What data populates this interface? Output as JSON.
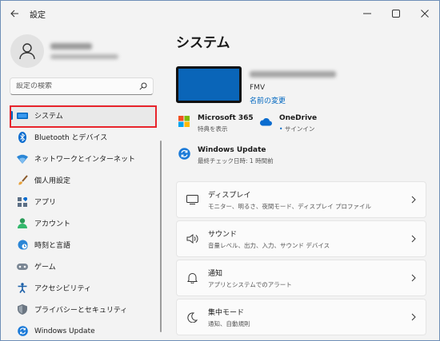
{
  "app": {
    "title": "設定"
  },
  "search": {
    "placeholder": "設定の検索"
  },
  "sidebar": {
    "items": [
      {
        "label": "システム",
        "icon": "monitor-icon",
        "active": true
      },
      {
        "label": "Bluetooth とデバイス",
        "icon": "bluetooth-icon"
      },
      {
        "label": "ネットワークとインターネット",
        "icon": "wifi-icon"
      },
      {
        "label": "個人用設定",
        "icon": "brush-icon"
      },
      {
        "label": "アプリ",
        "icon": "apps-icon"
      },
      {
        "label": "アカウント",
        "icon": "account-icon"
      },
      {
        "label": "時刻と言語",
        "icon": "globe-clock-icon"
      },
      {
        "label": "ゲーム",
        "icon": "gamepad-icon"
      },
      {
        "label": "アクセシビリティ",
        "icon": "accessibility-icon"
      },
      {
        "label": "プライバシーとセキュリティ",
        "icon": "shield-icon"
      },
      {
        "label": "Windows Update",
        "icon": "update-icon"
      }
    ]
  },
  "main": {
    "title": "システム",
    "device": {
      "model": "FMV",
      "rename_link": "名前の変更"
    },
    "quick": {
      "m365": {
        "title": "Microsoft 365",
        "sub": "特典を表示"
      },
      "onedrive": {
        "title": "OneDrive",
        "sub_dot": "•",
        "sub": "サインイン"
      },
      "winupdate": {
        "title": "Windows Update",
        "sub": "最終チェック日時: 1 時間前"
      }
    },
    "cards": [
      {
        "title": "ディスプレイ",
        "sub": "モニター、明るさ、夜間モード、ディスプレイ プロファイル",
        "icon": "display-icon"
      },
      {
        "title": "サウンド",
        "sub": "音量レベル、出力、入力、サウンド デバイス",
        "icon": "speaker-icon"
      },
      {
        "title": "通知",
        "sub": "アプリとシステムでのアラート",
        "icon": "bell-icon"
      },
      {
        "title": "集中モード",
        "sub": "通知、自動規則",
        "icon": "moon-icon"
      }
    ]
  },
  "colors": {
    "accent": "#0067c0",
    "highlight": "#e8242c",
    "device": "#0a65b8"
  }
}
